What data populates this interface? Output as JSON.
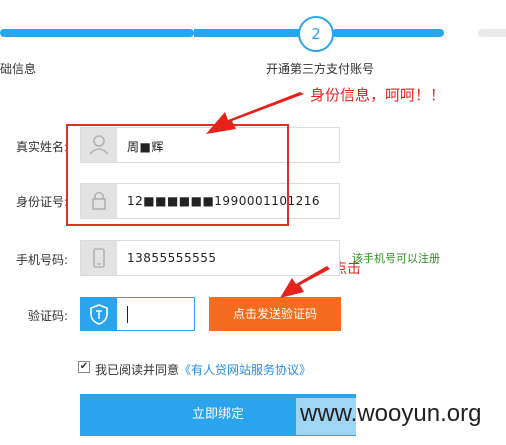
{
  "progress": {
    "step_number": "2"
  },
  "steps": {
    "left_label": "基础信息",
    "right_label": "开通第三方支付账号"
  },
  "annotations": {
    "id_info": "身份信息，呵呵！！",
    "click": "点击"
  },
  "form": {
    "name_label": "真实姓名:",
    "name_value": "周■辉",
    "id_label": "身份证号:",
    "id_value": "12■■■■■■1990001101216",
    "phone_label": "手机号码:",
    "phone_value": "13855555555",
    "phone_hint": "该手机号可以注册",
    "code_label": "验证码:",
    "send_code_label": "点击发送验证码"
  },
  "agreement": {
    "checked": true,
    "text": "我已阅读并同意",
    "link": "《有人贷网站服务协议》"
  },
  "submit_label": "立即绑定",
  "watermark": "www.wooyun.org",
  "colors": {
    "accent": "#2aa4ec",
    "orange": "#f56c1e",
    "annotation_red": "#e5231b",
    "hint_green": "#2f8f1f"
  }
}
